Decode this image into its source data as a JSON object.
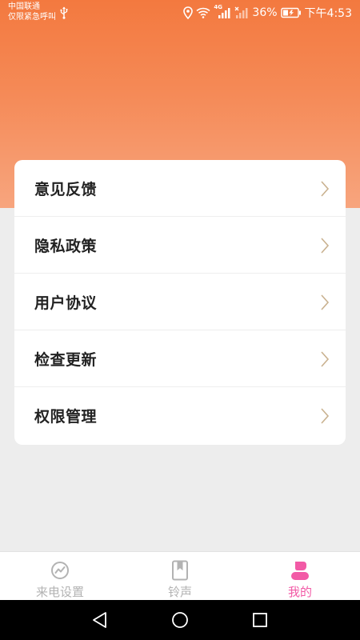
{
  "status_bar": {
    "carrier_line1": "中国联通",
    "carrier_line2": "仅限紧急呼叫",
    "network_label": "4G",
    "battery_percent": "36%",
    "time": "下午4:53"
  },
  "menu": {
    "items": [
      {
        "label": "意见反馈"
      },
      {
        "label": "隐私政策"
      },
      {
        "label": "用户协议"
      },
      {
        "label": "检查更新"
      },
      {
        "label": "权限管理"
      }
    ]
  },
  "tab_bar": {
    "tabs": [
      {
        "label": "来电设置",
        "icon": "trend-circle-icon",
        "active": false
      },
      {
        "label": "铃声",
        "icon": "book-icon",
        "active": false
      },
      {
        "label": "我的",
        "icon": "user-icon",
        "active": true
      }
    ]
  },
  "colors": {
    "header_gradient_top": "#f3793f",
    "header_gradient_bottom": "#f7a57e",
    "active_tab": "#f25aa6",
    "inactive_tab": "#b3b3b3",
    "chevron": "#c9b18f"
  },
  "nav_bar": {
    "buttons": [
      "back-icon",
      "home-icon",
      "recents-icon"
    ]
  }
}
